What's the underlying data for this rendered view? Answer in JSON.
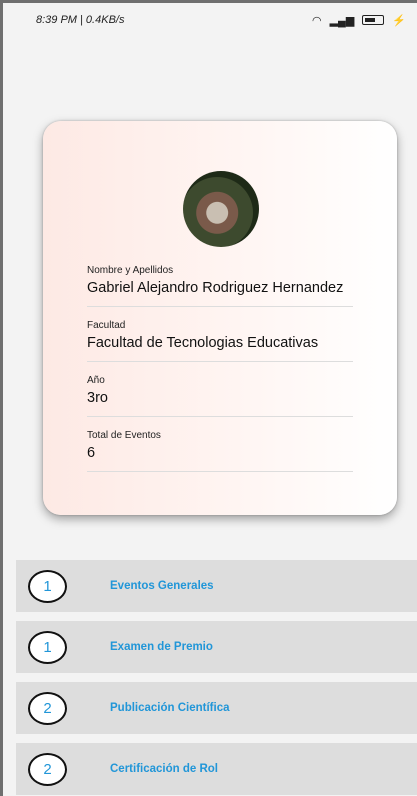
{
  "status_bar": {
    "left": "8:39 PM | 0.4KB/s",
    "right_signal": "⋮▐▐▐",
    "right_wifi": "wifi"
  },
  "profile": {
    "fields": [
      {
        "label": "Nombre y Apellidos",
        "value": "Gabriel Alejandro Rodriguez Hernandez"
      },
      {
        "label": "Facultad",
        "value": "Facultad de Tecnologias Educativas"
      },
      {
        "label": "Año",
        "value": "3ro"
      },
      {
        "label": "Total de Eventos",
        "value": "6"
      }
    ]
  },
  "events": [
    {
      "count": "1",
      "title": "Eventos Generales"
    },
    {
      "count": "1",
      "title": "Examen de Premio"
    },
    {
      "count": "2",
      "title": "Publicación Científica"
    },
    {
      "count": "2",
      "title": "Certificación de Rol"
    }
  ],
  "colors": {
    "accent": "#2196d8",
    "row_bg": "#dddddd"
  }
}
